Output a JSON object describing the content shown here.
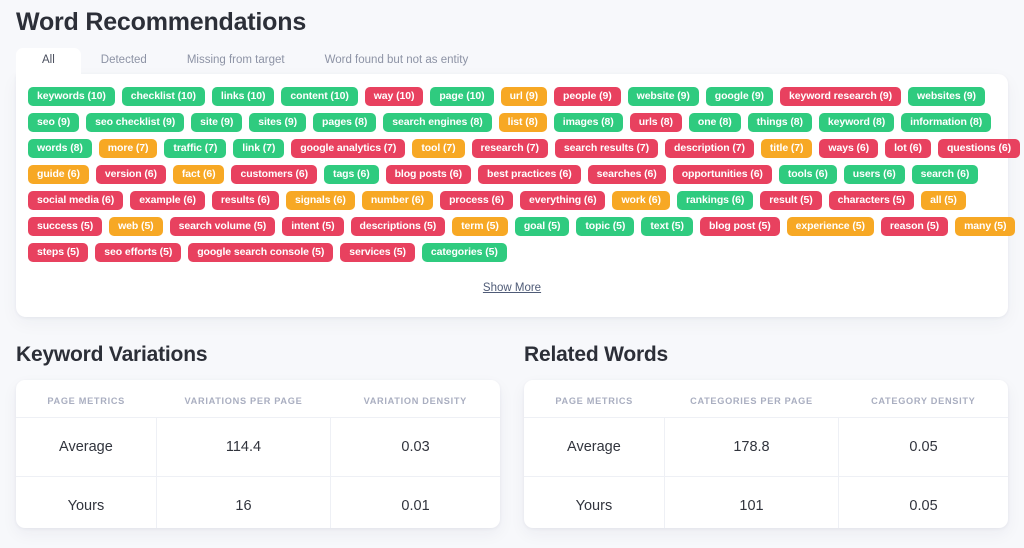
{
  "word_recommendations": {
    "title": "Word Recommendations",
    "tabs": [
      {
        "label": "All",
        "active": true
      },
      {
        "label": "Detected",
        "active": false
      },
      {
        "label": "Missing from target",
        "active": false
      },
      {
        "label": "Word found but not as entity",
        "active": false
      }
    ],
    "show_more_label": "Show More",
    "colors": {
      "green": "#2fcb7f",
      "red": "#e8415f",
      "orange": "#f7a824"
    },
    "tag_rows": [
      [
        {
          "label": "keywords (10)",
          "color": "green"
        },
        {
          "label": "checklist (10)",
          "color": "green"
        },
        {
          "label": "links (10)",
          "color": "green"
        },
        {
          "label": "content (10)",
          "color": "green"
        },
        {
          "label": "way (10)",
          "color": "red"
        },
        {
          "label": "page (10)",
          "color": "green"
        },
        {
          "label": "url (9)",
          "color": "orange"
        },
        {
          "label": "people (9)",
          "color": "red"
        },
        {
          "label": "website (9)",
          "color": "green"
        },
        {
          "label": "google (9)",
          "color": "green"
        },
        {
          "label": "keyword research (9)",
          "color": "red"
        },
        {
          "label": "websites (9)",
          "color": "green"
        }
      ],
      [
        {
          "label": "seo (9)",
          "color": "green"
        },
        {
          "label": "seo checklist (9)",
          "color": "green"
        },
        {
          "label": "site (9)",
          "color": "green"
        },
        {
          "label": "sites (9)",
          "color": "green"
        },
        {
          "label": "pages (8)",
          "color": "green"
        },
        {
          "label": "search engines (8)",
          "color": "green"
        },
        {
          "label": "list (8)",
          "color": "orange"
        },
        {
          "label": "images (8)",
          "color": "green"
        },
        {
          "label": "urls (8)",
          "color": "red"
        },
        {
          "label": "one (8)",
          "color": "green"
        },
        {
          "label": "things (8)",
          "color": "green"
        },
        {
          "label": "keyword (8)",
          "color": "green"
        },
        {
          "label": "information (8)",
          "color": "green"
        }
      ],
      [
        {
          "label": "words (8)",
          "color": "green"
        },
        {
          "label": "more (7)",
          "color": "orange"
        },
        {
          "label": "traffic (7)",
          "color": "green"
        },
        {
          "label": "link (7)",
          "color": "green"
        },
        {
          "label": "google analytics (7)",
          "color": "red"
        },
        {
          "label": "tool (7)",
          "color": "orange"
        },
        {
          "label": "research (7)",
          "color": "red"
        },
        {
          "label": "search results (7)",
          "color": "red"
        },
        {
          "label": "description (7)",
          "color": "red"
        },
        {
          "label": "title (7)",
          "color": "orange"
        },
        {
          "label": "ways (6)",
          "color": "red"
        },
        {
          "label": "lot (6)",
          "color": "red"
        },
        {
          "label": "questions (6)",
          "color": "red"
        }
      ],
      [
        {
          "label": "guide (6)",
          "color": "orange"
        },
        {
          "label": "version (6)",
          "color": "red"
        },
        {
          "label": "fact (6)",
          "color": "orange"
        },
        {
          "label": "customers (6)",
          "color": "red"
        },
        {
          "label": "tags (6)",
          "color": "green"
        },
        {
          "label": "blog posts (6)",
          "color": "red"
        },
        {
          "label": "best practices (6)",
          "color": "red"
        },
        {
          "label": "searches (6)",
          "color": "red"
        },
        {
          "label": "opportunities (6)",
          "color": "red"
        },
        {
          "label": "tools (6)",
          "color": "green"
        },
        {
          "label": "users (6)",
          "color": "green"
        },
        {
          "label": "search (6)",
          "color": "green"
        }
      ],
      [
        {
          "label": "social media (6)",
          "color": "red"
        },
        {
          "label": "example (6)",
          "color": "red"
        },
        {
          "label": "results (6)",
          "color": "red"
        },
        {
          "label": "signals (6)",
          "color": "orange"
        },
        {
          "label": "number (6)",
          "color": "orange"
        },
        {
          "label": "process (6)",
          "color": "red"
        },
        {
          "label": "everything (6)",
          "color": "red"
        },
        {
          "label": "work (6)",
          "color": "orange"
        },
        {
          "label": "rankings (6)",
          "color": "green"
        },
        {
          "label": "result (5)",
          "color": "red"
        },
        {
          "label": "characters (5)",
          "color": "red"
        },
        {
          "label": "all (5)",
          "color": "orange"
        }
      ],
      [
        {
          "label": "success (5)",
          "color": "red"
        },
        {
          "label": "web (5)",
          "color": "orange"
        },
        {
          "label": "search volume (5)",
          "color": "red"
        },
        {
          "label": "intent (5)",
          "color": "red"
        },
        {
          "label": "descriptions (5)",
          "color": "red"
        },
        {
          "label": "term (5)",
          "color": "orange"
        },
        {
          "label": "goal (5)",
          "color": "green"
        },
        {
          "label": "topic (5)",
          "color": "green"
        },
        {
          "label": "text (5)",
          "color": "green"
        },
        {
          "label": "blog post (5)",
          "color": "red"
        },
        {
          "label": "experience (5)",
          "color": "orange"
        },
        {
          "label": "reason (5)",
          "color": "red"
        },
        {
          "label": "many (5)",
          "color": "orange"
        }
      ],
      [
        {
          "label": "steps (5)",
          "color": "red"
        },
        {
          "label": "seo efforts (5)",
          "color": "red"
        },
        {
          "label": "google search console (5)",
          "color": "red"
        },
        {
          "label": "services (5)",
          "color": "red"
        },
        {
          "label": "categories (5)",
          "color": "green"
        }
      ]
    ]
  },
  "keyword_variations": {
    "title": "Keyword Variations",
    "headers": [
      "PAGE METRICS",
      "VARIATIONS PER PAGE",
      "VARIATION DENSITY"
    ],
    "rows": [
      [
        "Average",
        "114.4",
        "0.03"
      ],
      [
        "Yours",
        "16",
        "0.01"
      ]
    ]
  },
  "related_words": {
    "title": "Related Words",
    "headers": [
      "PAGE METRICS",
      "CATEGORIES PER PAGE",
      "CATEGORY DENSITY"
    ],
    "rows": [
      [
        "Average",
        "178.8",
        "0.05"
      ],
      [
        "Yours",
        "101",
        "0.05"
      ]
    ]
  }
}
